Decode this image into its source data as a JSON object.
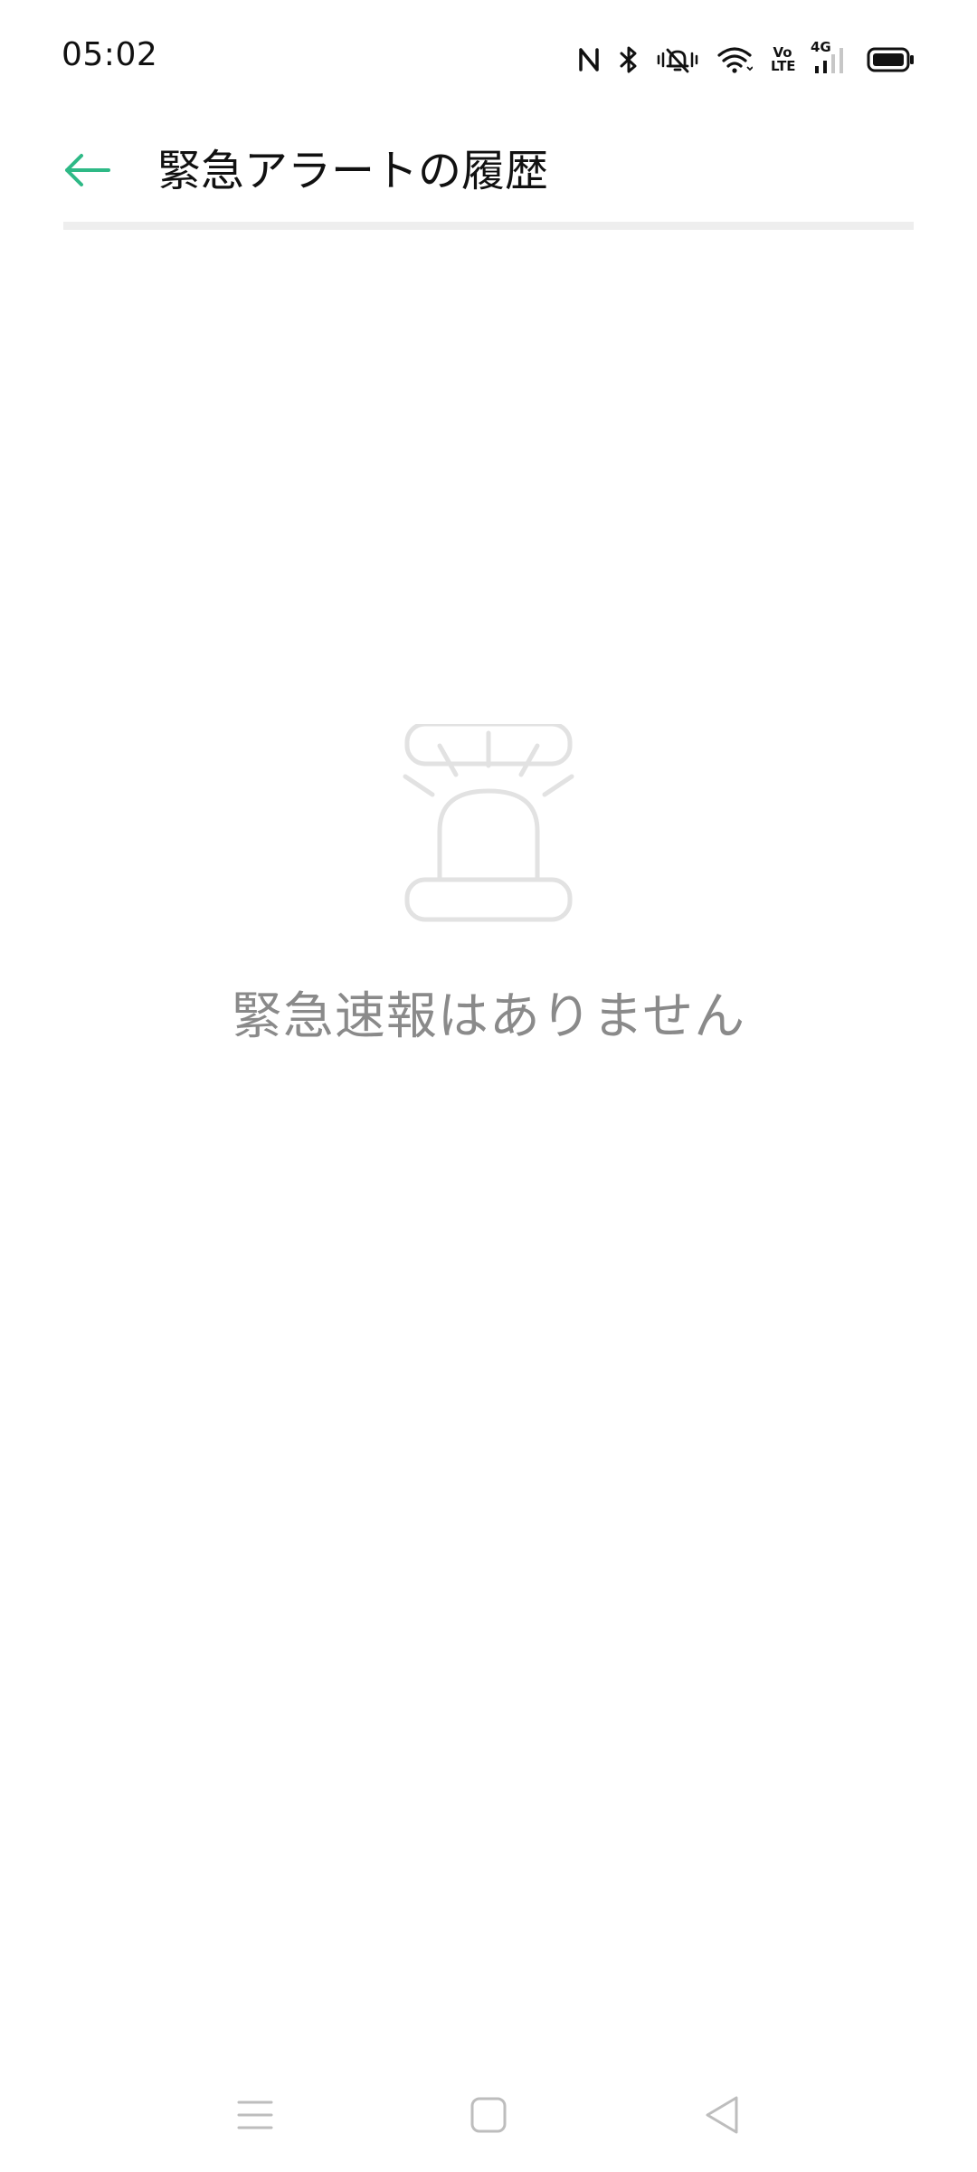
{
  "status_bar": {
    "time": "05:02",
    "icons": [
      "nfc-icon",
      "bluetooth-icon",
      "vibrate-icon",
      "wifi-icon",
      "volte-icon",
      "signal-4g-icon",
      "battery-icon"
    ],
    "volte_top": "Vo",
    "volte_bottom": "LTE",
    "network": "4G"
  },
  "header": {
    "title": "緊急アラートの履歴",
    "back_icon": "arrow-left-icon",
    "accent_color": "#2eb986"
  },
  "empty_state": {
    "icon": "siren-icon",
    "message": "緊急速報はありません",
    "icon_color": "#e2e2e2"
  },
  "nav_bar": {
    "items": [
      "menu-icon",
      "home-icon",
      "back-triangle-icon"
    ],
    "color": "#bdbdbd"
  }
}
